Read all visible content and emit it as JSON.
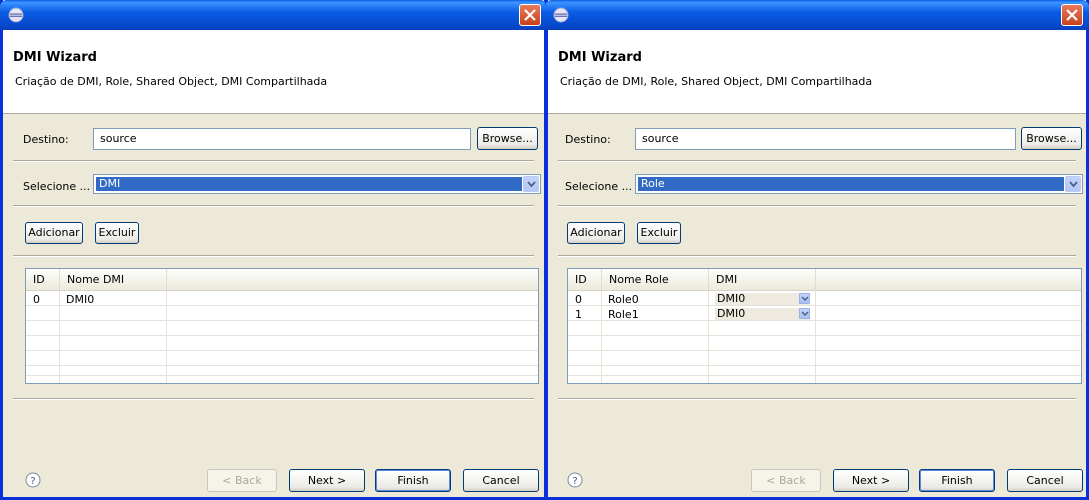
{
  "windows": [
    {
      "title": "DMI Wizard",
      "description": "Criação de DMI, Role, Shared Object, DMI Compartilhada",
      "destino_label": "Destino:",
      "destino_value": "source",
      "browse_label": "Browse...",
      "selecione_label": "Selecione ...",
      "selecione_value": "DMI",
      "adicionar_label": "Adicionar",
      "excluir_label": "Excluir",
      "table": {
        "columns": [
          "ID",
          "Nome DMI"
        ],
        "rows": [
          [
            "0",
            "DMI0"
          ]
        ]
      },
      "footer": {
        "back_label": "< Back",
        "next_label": "Next >",
        "finish_label": "Finish",
        "cancel_label": "Cancel"
      }
    },
    {
      "title": "DMI Wizard",
      "description": "Criação de DMI, Role, Shared Object, DMI Compartilhada",
      "destino_label": "Destino:",
      "destino_value": "source",
      "browse_label": "Browse...",
      "selecione_label": "Selecione ...",
      "selecione_value": "Role",
      "adicionar_label": "Adicionar",
      "excluir_label": "Excluir",
      "table": {
        "columns": [
          "ID",
          "Nome Role",
          "DMI"
        ],
        "rows": [
          [
            "0",
            "Role0",
            "DMI0"
          ],
          [
            "1",
            "Role1",
            "DMI0"
          ]
        ]
      },
      "footer": {
        "back_label": "< Back",
        "next_label": "Next >",
        "finish_label": "Finish",
        "cancel_label": "Cancel"
      }
    }
  ],
  "icons": {
    "app": "eclipse-icon",
    "close": "close-icon",
    "help": "help-icon",
    "dropdown": "chevron-down-icon"
  },
  "colors": {
    "titlebar": "#0a5ce4",
    "window_bg": "#ece9d8",
    "selection": "#316ac5",
    "close": "#c8421c"
  }
}
